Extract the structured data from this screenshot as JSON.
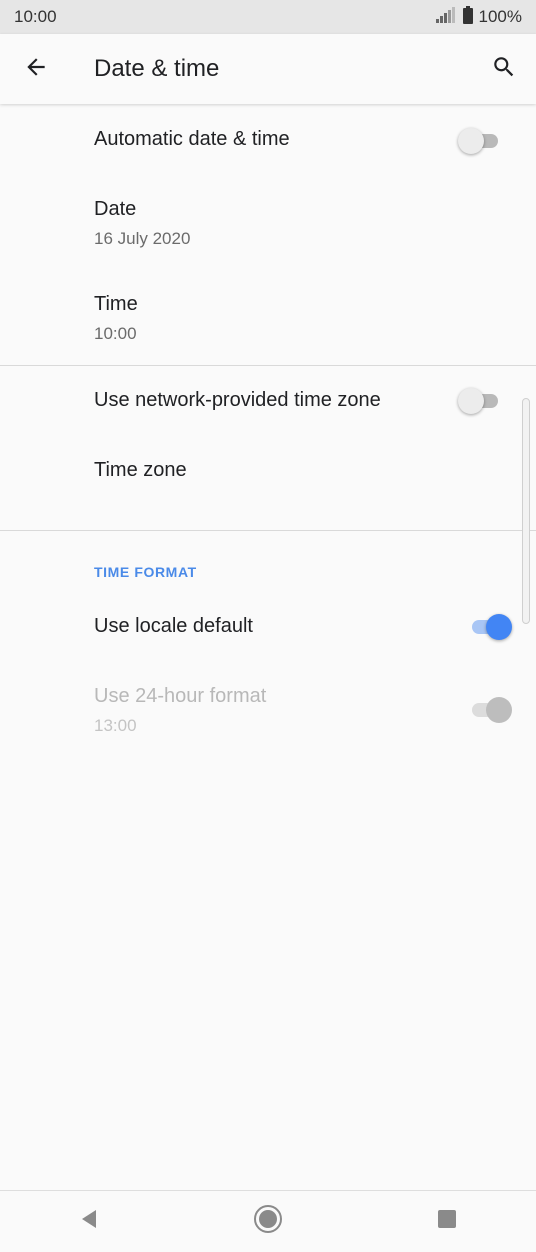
{
  "status_bar": {
    "time": "10:00",
    "battery": "100%",
    "icons": [
      "signal-icon",
      "battery-icon"
    ]
  },
  "app_bar": {
    "title": "Date & time",
    "icons": [
      "back-arrow-icon",
      "search-icon"
    ]
  },
  "settings": {
    "automatic": {
      "title": "Automatic date & time",
      "enabled": false
    },
    "date": {
      "title": "Date",
      "summary": "16 July 2020"
    },
    "time": {
      "title": "Time",
      "summary": "10:00"
    },
    "network_tz": {
      "title": "Use network-provided time zone",
      "enabled": false
    },
    "time_zone": {
      "title": "Time zone"
    },
    "time_format": {
      "header": "TIME FORMAT",
      "locale_default": {
        "title": "Use locale default",
        "enabled": true
      },
      "hour24": {
        "title": "Use 24-hour format",
        "summary": "13:00",
        "enabled": true,
        "disabled": true
      }
    }
  },
  "colors": {
    "accent": "#4285f4",
    "section_header": "#4a8ae8",
    "background": "#fafafa"
  },
  "nav_bar": {
    "icons": [
      "nav-back-icon",
      "nav-home-icon",
      "nav-recents-icon"
    ]
  }
}
